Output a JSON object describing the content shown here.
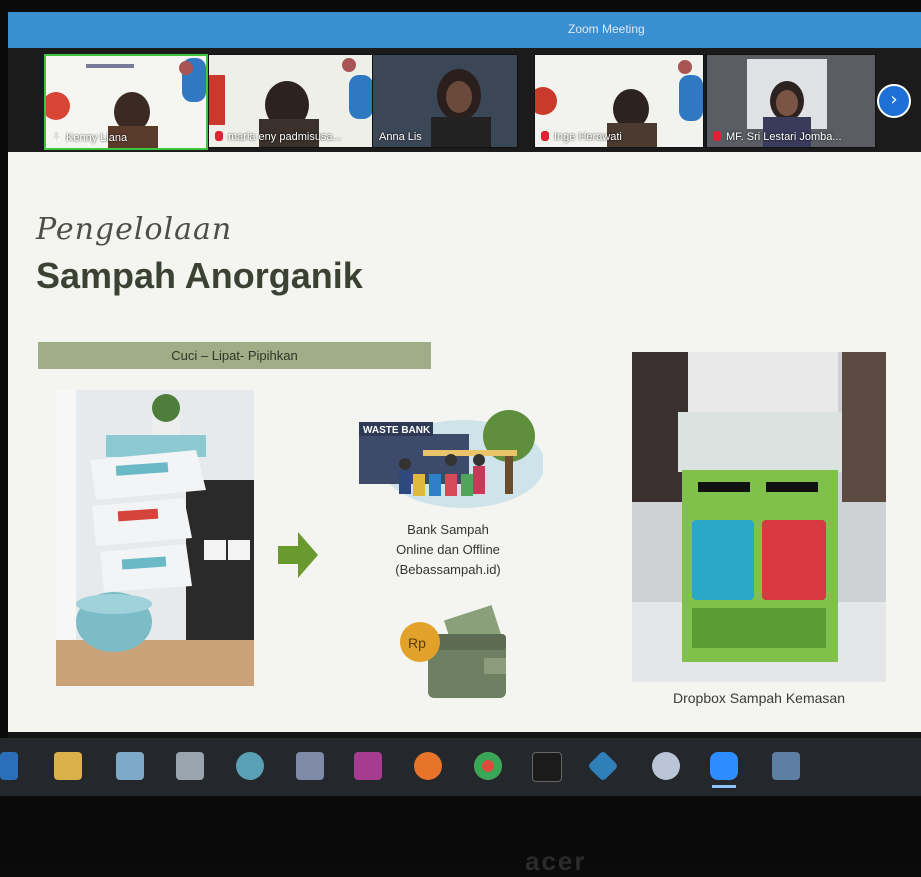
{
  "window": {
    "title": "Zoom Meeting"
  },
  "participants": [
    {
      "name": "Kenny Liana",
      "status": "pinned"
    },
    {
      "name": "maria eny padmisusa...",
      "status": "muted"
    },
    {
      "name": "Anna Lis",
      "status": "none"
    },
    {
      "name": "Inge Herawati",
      "status": "muted"
    },
    {
      "name": "MF. Sri Lestari Jomba...",
      "status": "muted"
    }
  ],
  "nav": {
    "next_icon": "chevron-right-icon",
    "next_glyph": "›"
  },
  "slide": {
    "script_title": "Pengelolaan",
    "main_title": "Sampah Anorganik",
    "section_label": "Cuci – Lipat- Pipihkan",
    "bank": {
      "sign": "WASTE BANK",
      "caption_lines": [
        "Bank Sampah",
        "Online dan Offline",
        "(Bebassampah.id)"
      ]
    },
    "wallet_badge": "Rp",
    "dropbox_caption": "Dropbox Sampah Kemasan"
  },
  "taskbar": {
    "icons": [
      "task-view-icon",
      "file-explorer-icon",
      "photos-icon",
      "printer-icon",
      "paint-icon",
      "settings-icon",
      "camera-app-icon",
      "firefox-icon",
      "chrome-icon",
      "terminal-icon",
      "kodi-icon",
      "palette-icon",
      "zoom-icon",
      "window-icon"
    ],
    "active": "zoom-icon"
  },
  "bezel": {
    "brand": "acer"
  },
  "colors": {
    "zoom_blue": "#3a8fd0",
    "slide_bg": "#f4f5f1",
    "section_green": "#9fae86",
    "title_dark": "#3c4233",
    "arrow_green": "#6a9a2e"
  }
}
